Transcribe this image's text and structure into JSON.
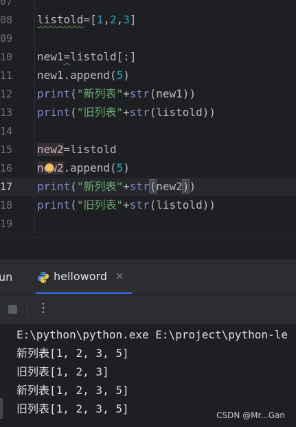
{
  "editor": {
    "lines": [
      {
        "number": "07",
        "text": ""
      },
      {
        "number": "08",
        "text": "listold=[1,2,3]"
      },
      {
        "number": "09",
        "text": ""
      },
      {
        "number": "10",
        "text": "new1=listold[:]"
      },
      {
        "number": "11",
        "text": "new1.append(5)"
      },
      {
        "number": "12",
        "text": "print(\"新列表\"+str(new1))"
      },
      {
        "number": "13",
        "text": "print(\"旧列表\"+str(listold))"
      },
      {
        "number": "14",
        "text": ""
      },
      {
        "number": "15",
        "text": "new2=listold"
      },
      {
        "number": "16",
        "text": "new2.append(5)"
      },
      {
        "number": "17",
        "text": "print(\"新列表\"+str(new2))"
      },
      {
        "number": "18",
        "text": "print(\"旧列表\"+str(listold))"
      },
      {
        "number": "19",
        "text": ""
      }
    ],
    "current_line": "17"
  },
  "tool_window": {
    "run_label": "un",
    "tab_label": "helloword",
    "tab_close": "×",
    "more_label": "⋮"
  },
  "console": {
    "lines": [
      "E:\\python\\python.exe E:\\project\\python-le",
      "新列表[1, 2, 3, 5]",
      "旧列表[1, 2, 3]",
      "新列表[1, 2, 3, 5]",
      "旧列表[1, 2, 3, 5]"
    ]
  },
  "watermark": "CSDN @Mr...Gan",
  "colors": {
    "background": "#1e1f22",
    "keyword": "#8888c6",
    "string": "#6aab73",
    "number": "#2aacb8",
    "accent": "#3574f0"
  }
}
